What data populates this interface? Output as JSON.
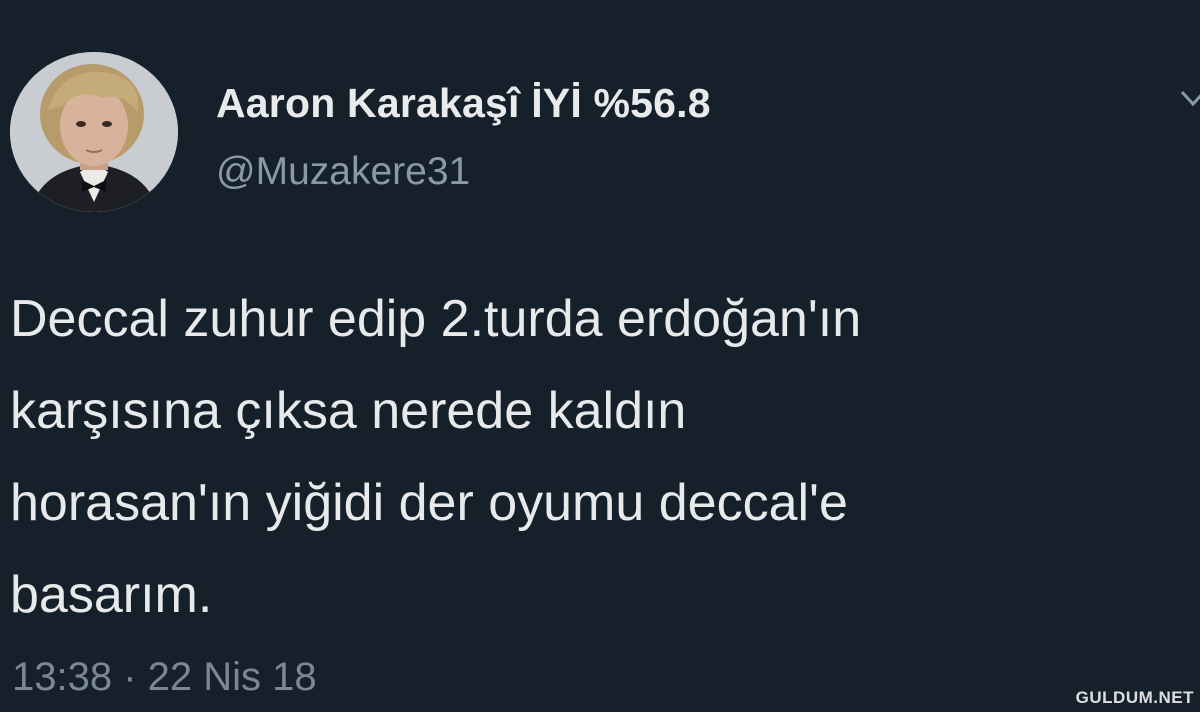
{
  "tweet": {
    "author": {
      "display_name": "Aaron Karakaşî İYİ %56.8",
      "handle": "@Muzakere31",
      "avatar": "profile-photo"
    },
    "menu_icon": "chevron-down-icon",
    "text_lines": [
      "Deccal zuhur edip 2.turda erdoğan'ın",
      "karşısına çıksa nerede kaldın",
      "horasan'ın yiğidi der oyumu deccal'e",
      "basarım."
    ],
    "timestamp": "13:38 · 22 Nis 18"
  },
  "watermark": "GULDUM.NET",
  "colors": {
    "background": "#15202b",
    "primary_text": "#e7e9ea",
    "secondary_text": "#8b98a5"
  }
}
